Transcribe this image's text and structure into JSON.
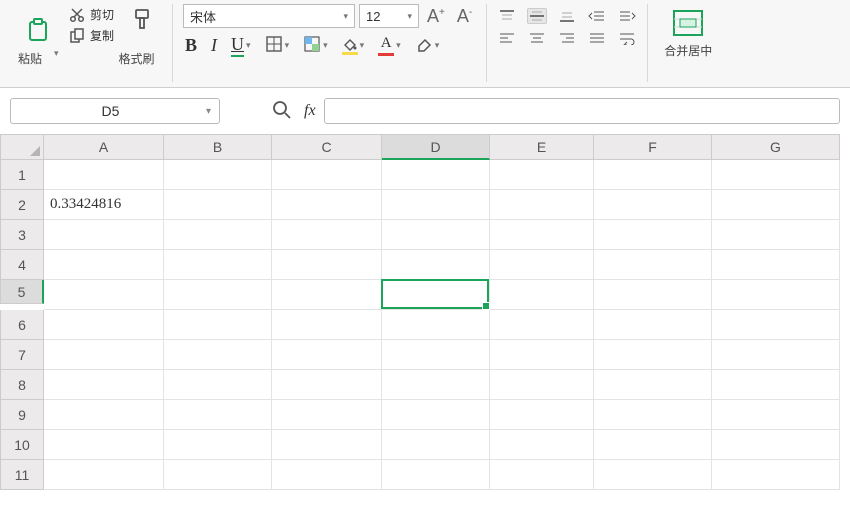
{
  "ribbon": {
    "clipboard": {
      "paste_label": "粘贴",
      "cut_label": "剪切",
      "copy_label": "复制",
      "format_painter_label": "格式刷"
    },
    "font": {
      "name": "宋体",
      "size": "12",
      "bold_glyph": "B",
      "italic_glyph": "I",
      "underline_glyph": "U",
      "font_color": "#e33a3a",
      "fill_color": "#f7d94c"
    },
    "increase_font_glyph": "A",
    "decrease_font_glyph": "A",
    "merge": {
      "label": "合并居中"
    }
  },
  "namebox": {
    "value": "D5",
    "fx_label": "fx"
  },
  "grid": {
    "columns": [
      "A",
      "B",
      "C",
      "D",
      "E",
      "F",
      "G"
    ],
    "rows": [
      1,
      2,
      3,
      4,
      5,
      6,
      7,
      8,
      9,
      10,
      11
    ],
    "selected_col_index": 3,
    "selected_row_index": 4,
    "cells": {
      "A2": "0.33424816"
    }
  }
}
